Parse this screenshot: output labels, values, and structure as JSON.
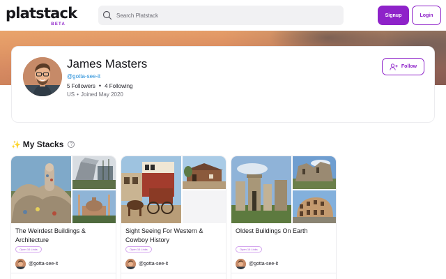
{
  "header": {
    "logo_text": "platstack",
    "logo_badge": "BETA",
    "search_placeholder": "Search Platstack",
    "signup_label": "Signup",
    "login_label": "Login",
    "accent_color": "#8e22c9"
  },
  "profile": {
    "name": "James Masters",
    "handle": "@gotta-see-it",
    "followers": "5 Followers",
    "following": "4 Following",
    "country": "US",
    "joined": "Joined May 2020",
    "follow_label": "Follow"
  },
  "section": {
    "title": "My Stacks",
    "icon": "sparkle-icon",
    "help_icon": "?"
  },
  "stacks": [
    {
      "title": "The Weirdest Buildings & Architecture",
      "badge": "Open 16 Links",
      "owner": "@gotta-see-it"
    },
    {
      "title": "Sight Seeing For Western & Cowboy History",
      "badge": "Open 16 Links",
      "owner": "@gotta-see-it"
    },
    {
      "title": "Oldest Buildings On Earth",
      "badge": "Open 16 Links",
      "owner": "@gotta-see-it"
    }
  ]
}
